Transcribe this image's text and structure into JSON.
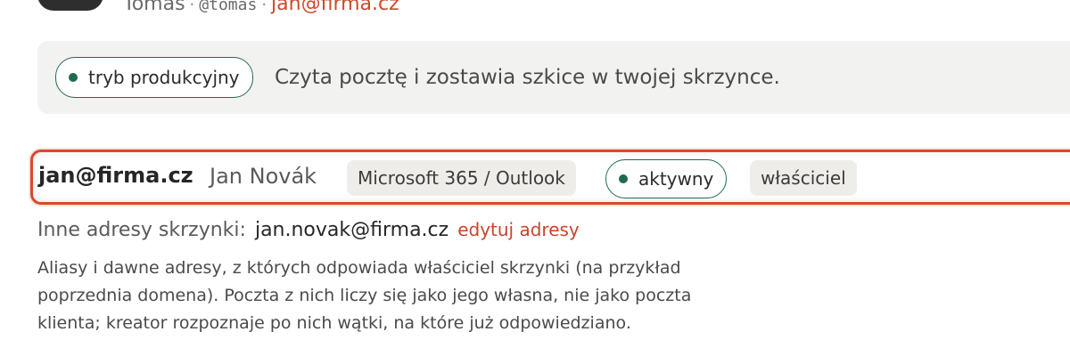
{
  "user": {
    "name": "Tomas",
    "separator": "·",
    "handle": "@tomas",
    "email": "jan@firma.cz"
  },
  "mode": {
    "label": "tryb produkcyjny",
    "description": "Czyta pocztę i zostawia szkice w twojej skrzynce."
  },
  "account": {
    "email": "jan@firma.cz",
    "name": "Jan Novák",
    "provider": "Microsoft 365 / Outlook",
    "status": "aktywny",
    "role": "właściciel"
  },
  "aliases": {
    "label": "Inne adresy skrzynki:",
    "value": "jan.novak@firma.cz",
    "edit_label": "edytuj adresy",
    "help": "Aliasy i dawne adresy, z których odpowiada właściciel skrzynki (na przykład poprzednia domena). Poczta z nich liczy się jako jego własna, nie jako poczta klienta; kreator rozpoznaje po nich wątki, na które już odpowiedziano."
  },
  "colors": {
    "accent": "#d84a2c",
    "status_green": "#1f6b4e",
    "panel_bg": "#f2f2f0"
  }
}
